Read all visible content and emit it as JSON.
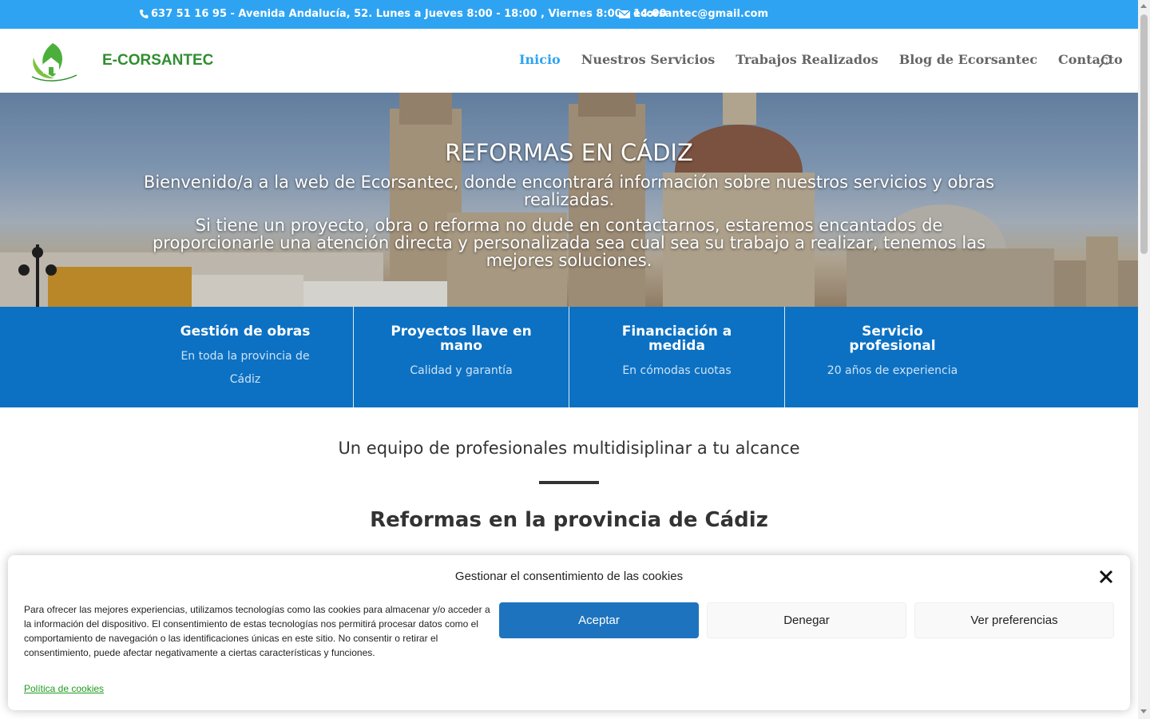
{
  "topbar": {
    "phone": "637 51 16 95 - Avenida Andalucía, 52. Lunes a Jueves 8:00 - 18:00 , Viernes 8:00 - 14:00",
    "email": "ecorsantec@gmail.com"
  },
  "header": {
    "brand": "E-CORSANTEC",
    "nav": [
      {
        "label": "Inicio",
        "active": true
      },
      {
        "label": "Nuestros Servicios"
      },
      {
        "label": "Trabajos Realizados"
      },
      {
        "label": "Blog de Ecorsantec"
      },
      {
        "label": "Contacto"
      }
    ]
  },
  "hero": {
    "title": "REFORMAS EN CÁDIZ",
    "p1": "Bienvenido/a a la web de Ecorsantec, donde encontrará información sobre nuestros servicios y obras realizadas.",
    "p2": "Si tiene un proyecto, obra o reforma no dude en contactarnos, estaremos encantados de proporcionarle una atención directa y personalizada sea cual sea su trabajo a realizar, tenemos las mejores soluciones."
  },
  "features": [
    {
      "title": "Gestión de obras",
      "text": "En toda la provincia de Cádiz"
    },
    {
      "title": "Proyectos llave en mano",
      "text": "Calidad y garantía"
    },
    {
      "title": "Financiación a medida",
      "text": "En cómodas cuotas"
    },
    {
      "title": "Servicio profesional",
      "text": "20 años de experiencia"
    }
  ],
  "content": {
    "tagline": "Un equipo de profesionales multidisiplinar a tu alcance",
    "section_title": "Reformas en la provincia de Cádiz"
  },
  "cookie": {
    "title": "Gestionar el consentimiento de las cookies",
    "text": "Para ofrecer las mejores experiencias, utilizamos tecnologías como las cookies para almacenar y/o acceder a la información del dispositivo. El consentimiento de estas tecnologías nos permitirá procesar datos como el comportamiento de navegación o las identificaciones únicas en este sitio. No consentir o retirar el consentimiento, puede afectar negativamente a ciertas características y funciones.",
    "link": "Política de cookies",
    "accept": "Aceptar",
    "deny": "Denegar",
    "prefs": "Ver preferencias"
  },
  "colors": {
    "topbar": "#2ea3f2",
    "features": "#0c71c3",
    "accept": "#1e73be",
    "brand": "#2f8e2f"
  },
  "icons": {
    "phone": "phone-icon",
    "email": "envelope-icon",
    "search": "search-icon",
    "close": "close-icon",
    "logo": "leaf-house-icon"
  }
}
